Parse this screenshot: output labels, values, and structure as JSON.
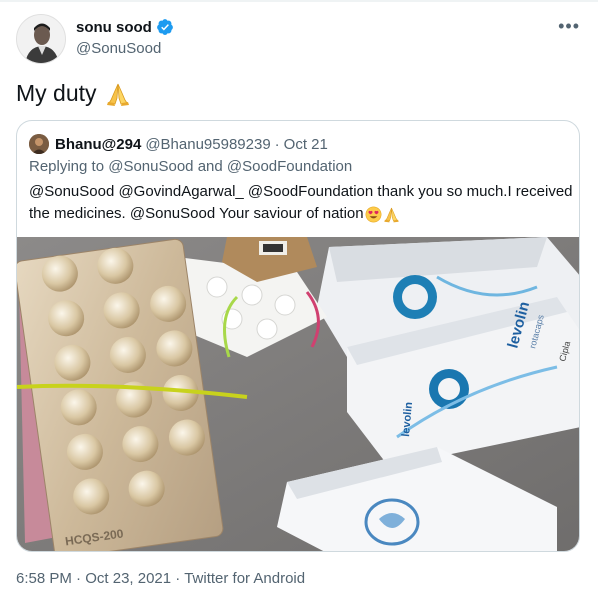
{
  "author": {
    "display_name": "sonu sood",
    "handle": "@SonuSood",
    "verified": true,
    "accent_color": "#1d9bf0"
  },
  "menu": {
    "more_label": "•••"
  },
  "tweet": {
    "text": "My duty",
    "emoji": "folded-hands"
  },
  "quoted": {
    "display_name": "Bhanu@294",
    "handle": "@Bhanu95989239",
    "separator": "·",
    "date": "Oct 21",
    "reply_prefix": "Replying to",
    "reply_to_1": "@SonuSood",
    "reply_and": "and",
    "reply_to_2": "@SoodFoundation",
    "text_line1": "@SonuSood @GovindAgarwal_ @SoodFoundation thank you so much.I received",
    "text_line2": "the medicines. @SonuSood Your saviour of nation",
    "text_emojis": [
      "heart-eyes-face",
      "folded-hands"
    ],
    "image": {
      "pack_labels": [
        "levolin",
        "rotacaps",
        "levolin",
        "Cipla"
      ],
      "strip_label": "HCQS-200"
    }
  },
  "footer": {
    "time": "6:58 PM",
    "separator": "·",
    "date": "Oct 23, 2021",
    "source": "Twitter for Android"
  }
}
